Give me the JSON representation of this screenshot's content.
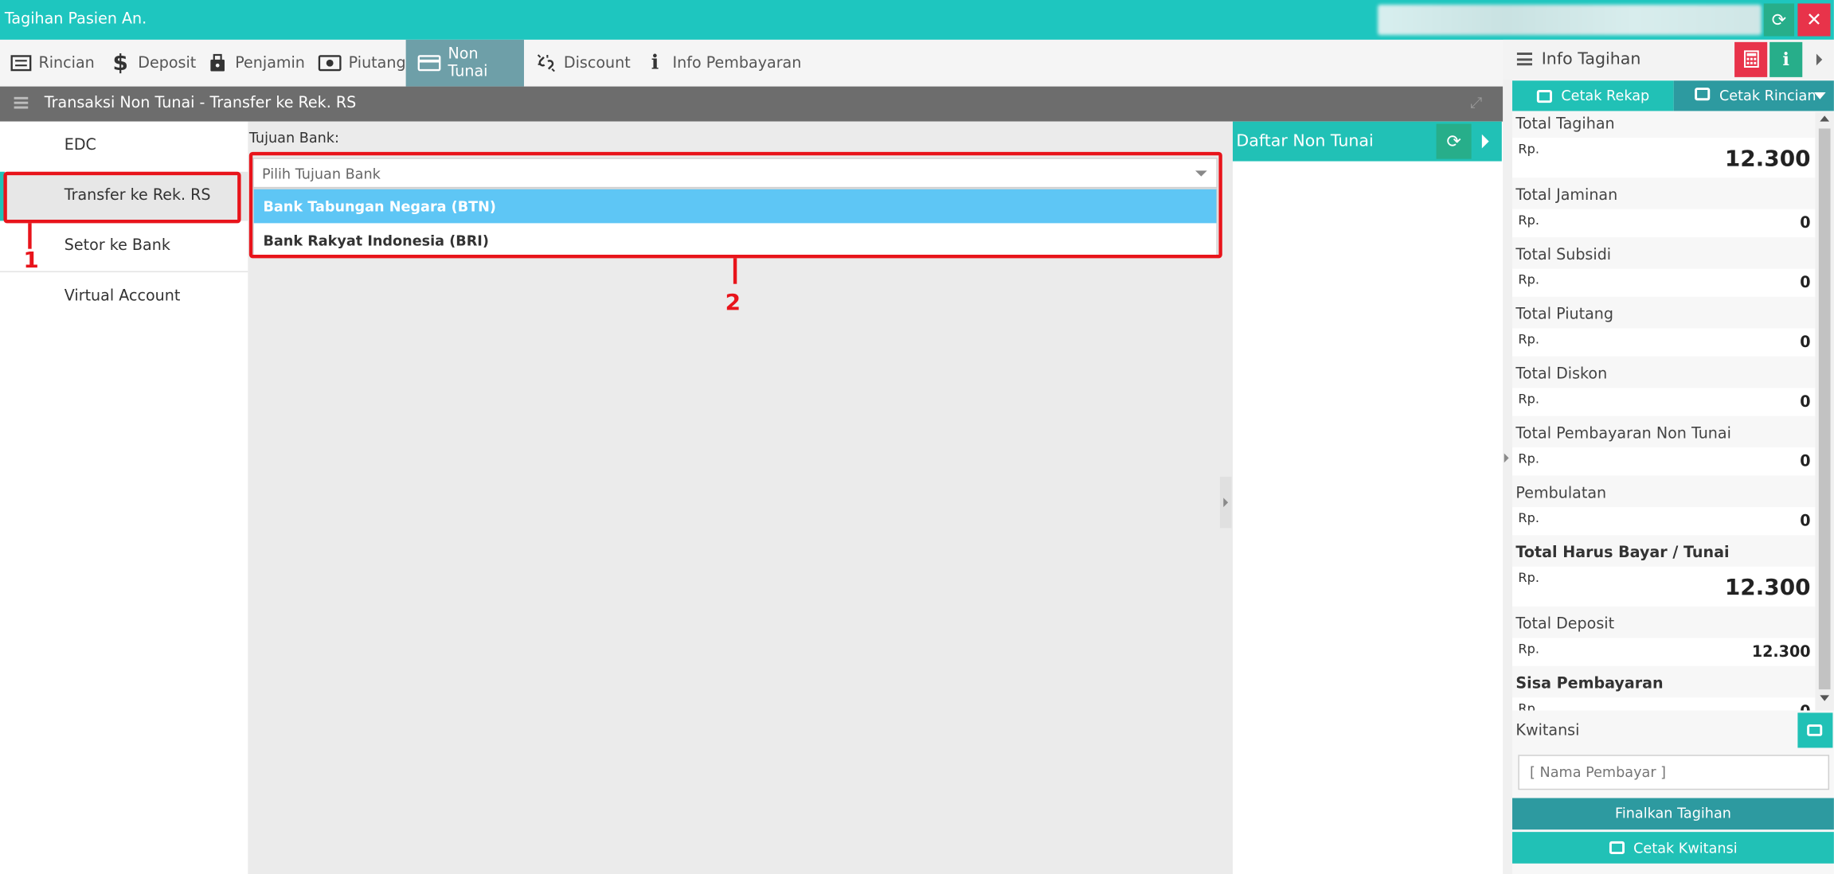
{
  "window": {
    "title": "Tagihan Pasien An."
  },
  "tabs": [
    {
      "label": "Rincian",
      "icon": "list-icon"
    },
    {
      "label": "Deposit",
      "icon": "dollar-icon"
    },
    {
      "label": "Penjamin",
      "icon": "briefcase-icon"
    },
    {
      "label": "Piutang",
      "icon": "banknote-icon"
    },
    {
      "label": "Non Tunai",
      "icon": "credit-card-icon",
      "active": true
    },
    {
      "label": "Discount",
      "icon": "broken-link-icon"
    },
    {
      "label": "Info Pembayaran",
      "icon": "info-icon"
    }
  ],
  "section": {
    "title": "Transaksi Non Tunai - Transfer ke Rek. RS"
  },
  "left_menu": {
    "items": [
      {
        "label": "EDC"
      },
      {
        "label": "Transfer ke Rek. RS",
        "selected": true
      },
      {
        "label": "Setor ke Bank"
      },
      {
        "label": "Virtual Account"
      }
    ]
  },
  "form": {
    "label": "Tujuan Bank:",
    "placeholder": "Pilih Tujuan Bank",
    "options": [
      {
        "label": "Bank Tabungan Negara (BTN)",
        "highlighted": true
      },
      {
        "label": "Bank Rakyat Indonesia (BRI)"
      }
    ]
  },
  "annotations": {
    "one": "1",
    "two": "2",
    "color": "#e8141b"
  },
  "daftar": {
    "title": "Daftar Non Tunai"
  },
  "info_panel": {
    "title": "Info Tagihan",
    "cetak_rekap": "Cetak Rekap",
    "cetak_rincian": "Cetak Rincian",
    "currency": "Rp.",
    "rows": [
      {
        "label": "Total Tagihan",
        "value": "12.300",
        "big": true
      },
      {
        "label": "Total Jaminan",
        "value": "0"
      },
      {
        "label": "Total Subsidi",
        "value": "0"
      },
      {
        "label": "Total Piutang",
        "value": "0"
      },
      {
        "label": "Total Diskon",
        "value": "0"
      },
      {
        "label": "Total Pembayaran Non Tunai",
        "value": "0"
      },
      {
        "label": "Pembulatan",
        "value": "0"
      },
      {
        "label": "Total Harus Bayar / Tunai",
        "value": "12.300",
        "big": true,
        "bold": true
      },
      {
        "label": "Total Deposit",
        "value": "12.300"
      },
      {
        "label": "Sisa Pembayaran",
        "value": "0",
        "bold": true
      }
    ],
    "kwitansi_label": "Kwitansi",
    "nama_placeholder": "[ Nama Pembayar ]",
    "finalkan": "Finalkan Tagihan",
    "cetak_kwitansi": "Cetak Kwitansi"
  },
  "colors": {
    "teal": "#1ec6bf",
    "dark_teal": "#2d9aa0",
    "green": "#27ae8a",
    "red": "#e8334a",
    "highlight": "#5ec6f5",
    "header_gray": "#6d6d6d"
  }
}
